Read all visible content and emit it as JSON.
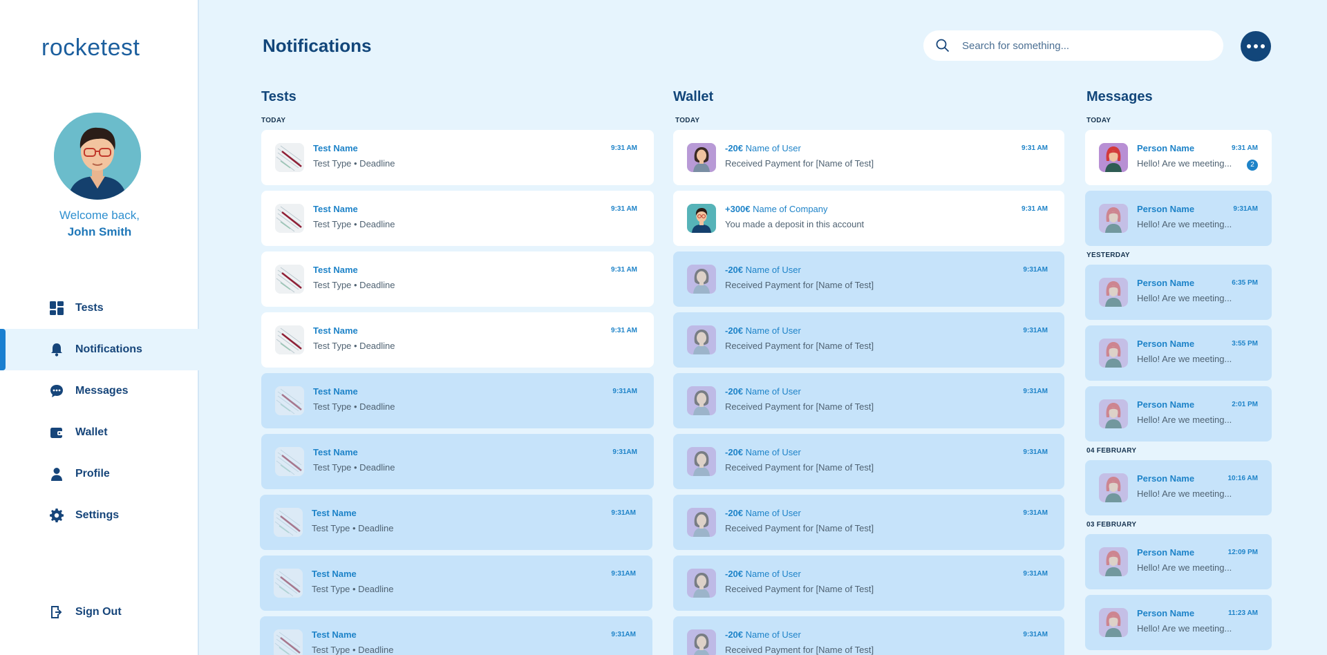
{
  "app": {
    "logo_text": "rocketest"
  },
  "user": {
    "welcome": "Welcome back,",
    "name": "John Smith"
  },
  "nav": {
    "items": [
      {
        "label": "Tests",
        "icon": "dashboard-icon",
        "active": false
      },
      {
        "label": "Notifications",
        "icon": "bell-icon",
        "active": true
      },
      {
        "label": "Messages",
        "icon": "chat-bubble-icon",
        "active": false
      },
      {
        "label": "Wallet",
        "icon": "wallet-icon",
        "active": false
      },
      {
        "label": "Profile",
        "icon": "person-icon",
        "active": false
      },
      {
        "label": "Settings",
        "icon": "gear-icon",
        "active": false
      }
    ],
    "signout": "Sign Out"
  },
  "header": {
    "title": "Notifications",
    "search_placeholder": "Search for something..."
  },
  "colors": {
    "background": "#e6f4fd",
    "accent": "#1e83c8",
    "primary_dark": "#12467a",
    "unread_card": "#ffffff",
    "read_card": "#c6e3fa"
  },
  "tests": {
    "title": "Tests",
    "section": "TODAY",
    "items": [
      {
        "title": "Test Name",
        "subtitle": "Test Type • Deadline",
        "time": "9:31 AM",
        "read": false
      },
      {
        "title": "Test Name",
        "subtitle": "Test Type • Deadline",
        "time": "9:31 AM",
        "read": false
      },
      {
        "title": "Test Name",
        "subtitle": "Test Type • Deadline",
        "time": "9:31 AM",
        "read": false
      },
      {
        "title": "Test Name",
        "subtitle": "Test Type • Deadline",
        "time": "9:31 AM",
        "read": false
      },
      {
        "title": "Test Name",
        "subtitle": "Test Type • Deadline",
        "time": "9:31AM",
        "read": true
      },
      {
        "title": "Test Name",
        "subtitle": "Test Type • Deadline",
        "time": "9:31AM",
        "read": true
      },
      {
        "title": "Test Name",
        "subtitle": "Test Type • Deadline",
        "time": "9:31AM",
        "read": true
      },
      {
        "title": "Test Name",
        "subtitle": "Test Type • Deadline",
        "time": "9:31AM",
        "read": true
      },
      {
        "title": "Test Name",
        "subtitle": "Test Type • Deadline",
        "time": "9:31AM",
        "read": true
      }
    ]
  },
  "wallet": {
    "title": "Wallet",
    "section": "TODAY",
    "items": [
      {
        "amount": "-20€",
        "who": "Name of User",
        "subtitle": "Received Payment for [Name of Test]",
        "time": "9:31 AM",
        "read": false,
        "avatar": "woman"
      },
      {
        "amount": "+300€",
        "who": "Name of Company",
        "subtitle": "You made a deposit in this account",
        "time": "9:31 AM",
        "read": false,
        "avatar": "man"
      },
      {
        "amount": "-20€",
        "who": "Name of User",
        "subtitle": "Received Payment for [Name of Test]",
        "time": "9:31AM",
        "read": true,
        "avatar": "woman"
      },
      {
        "amount": "-20€",
        "who": "Name of User",
        "subtitle": "Received Payment for [Name of Test]",
        "time": "9:31AM",
        "read": true,
        "avatar": "woman"
      },
      {
        "amount": "-20€",
        "who": "Name of User",
        "subtitle": "Received Payment for [Name of Test]",
        "time": "9:31AM",
        "read": true,
        "avatar": "woman"
      },
      {
        "amount": "-20€",
        "who": "Name of User",
        "subtitle": "Received Payment for [Name of Test]",
        "time": "9:31AM",
        "read": true,
        "avatar": "woman"
      },
      {
        "amount": "-20€",
        "who": "Name of User",
        "subtitle": "Received Payment for [Name of Test]",
        "time": "9:31AM",
        "read": true,
        "avatar": "woman"
      },
      {
        "amount": "-20€",
        "who": "Name of User",
        "subtitle": "Received Payment for [Name of Test]",
        "time": "9:31AM",
        "read": true,
        "avatar": "woman"
      },
      {
        "amount": "-20€",
        "who": "Name of User",
        "subtitle": "Received Payment for [Name of Test]",
        "time": "9:31AM",
        "read": true,
        "avatar": "woman"
      }
    ]
  },
  "messages": {
    "title": "Messages",
    "groups": [
      {
        "section": "TODAY",
        "items": [
          {
            "name": "Person Name",
            "text": "Hello! Are we meeting...",
            "time": "9:31 AM",
            "read": false,
            "badge": "2"
          },
          {
            "name": "Person Name",
            "text": "Hello! Are we meeting...",
            "time": "9:31AM",
            "read": true
          }
        ]
      },
      {
        "section": "YESTERDAY",
        "items": [
          {
            "name": "Person Name",
            "text": "Hello! Are we meeting...",
            "time": "6:35 PM",
            "read": true
          },
          {
            "name": "Person Name",
            "text": "Hello! Are we meeting...",
            "time": "3:55 PM",
            "read": true
          },
          {
            "name": "Person Name",
            "text": "Hello! Are we meeting...",
            "time": "2:01 PM",
            "read": true
          }
        ]
      },
      {
        "section": "04 FEBRUARY",
        "items": [
          {
            "name": "Person Name",
            "text": "Hello! Are we meeting...",
            "time": "10:16 AM",
            "read": true
          }
        ]
      },
      {
        "section": "03 FEBRUARY",
        "items": [
          {
            "name": "Person Name",
            "text": "Hello! Are we meeting...",
            "time": "12:09 PM",
            "read": true
          },
          {
            "name": "Person Name",
            "text": "Hello! Are we meeting...",
            "time": "11:23 AM",
            "read": true
          }
        ]
      }
    ]
  }
}
